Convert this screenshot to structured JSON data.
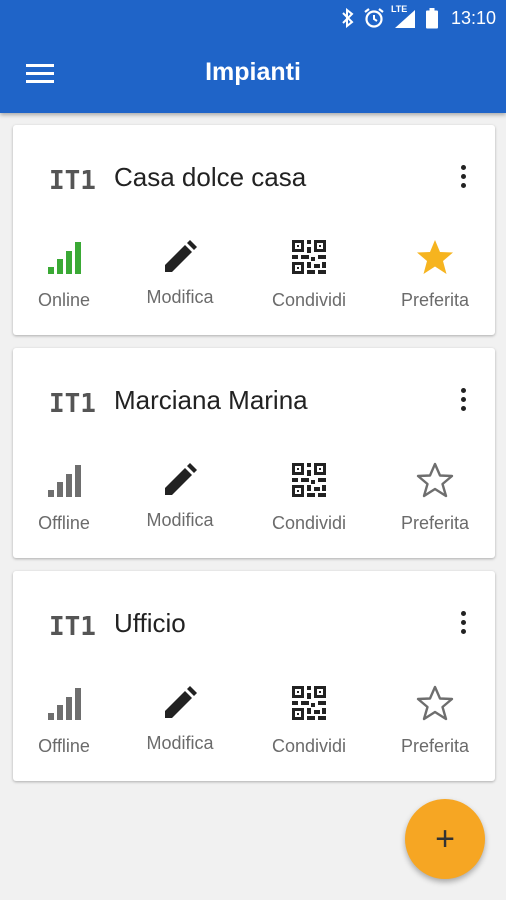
{
  "status_bar": {
    "time": "13:10",
    "network_label": "LTE",
    "icons": [
      "bluetooth-icon",
      "alarm-icon",
      "signal-icon",
      "battery-icon"
    ]
  },
  "toolbar": {
    "title": "Impianti",
    "menu_icon": "menu-icon"
  },
  "colors": {
    "appbar": "#1f64c8",
    "online": "#3aa935",
    "offline": "#6e6e6e",
    "favorite": "#f6b41f",
    "fab": "#f6a623"
  },
  "plants": [
    {
      "logo": "IT1",
      "name": "Casa dolce casa",
      "status_label": "Online",
      "status": "online",
      "edit_label": "Modifica",
      "share_label": "Condividi",
      "favorite_label": "Preferita",
      "favorite": true
    },
    {
      "logo": "IT1",
      "name": "Marciana Marina",
      "status_label": "Offline",
      "status": "offline",
      "edit_label": "Modifica",
      "share_label": "Condividi",
      "favorite_label": "Preferita",
      "favorite": false
    },
    {
      "logo": "IT1",
      "name": "Ufficio",
      "status_label": "Offline",
      "status": "offline",
      "edit_label": "Modifica",
      "share_label": "Condividi",
      "favorite_label": "Preferita",
      "favorite": false
    }
  ],
  "fab": {
    "label": "+",
    "icon": "add-icon"
  }
}
